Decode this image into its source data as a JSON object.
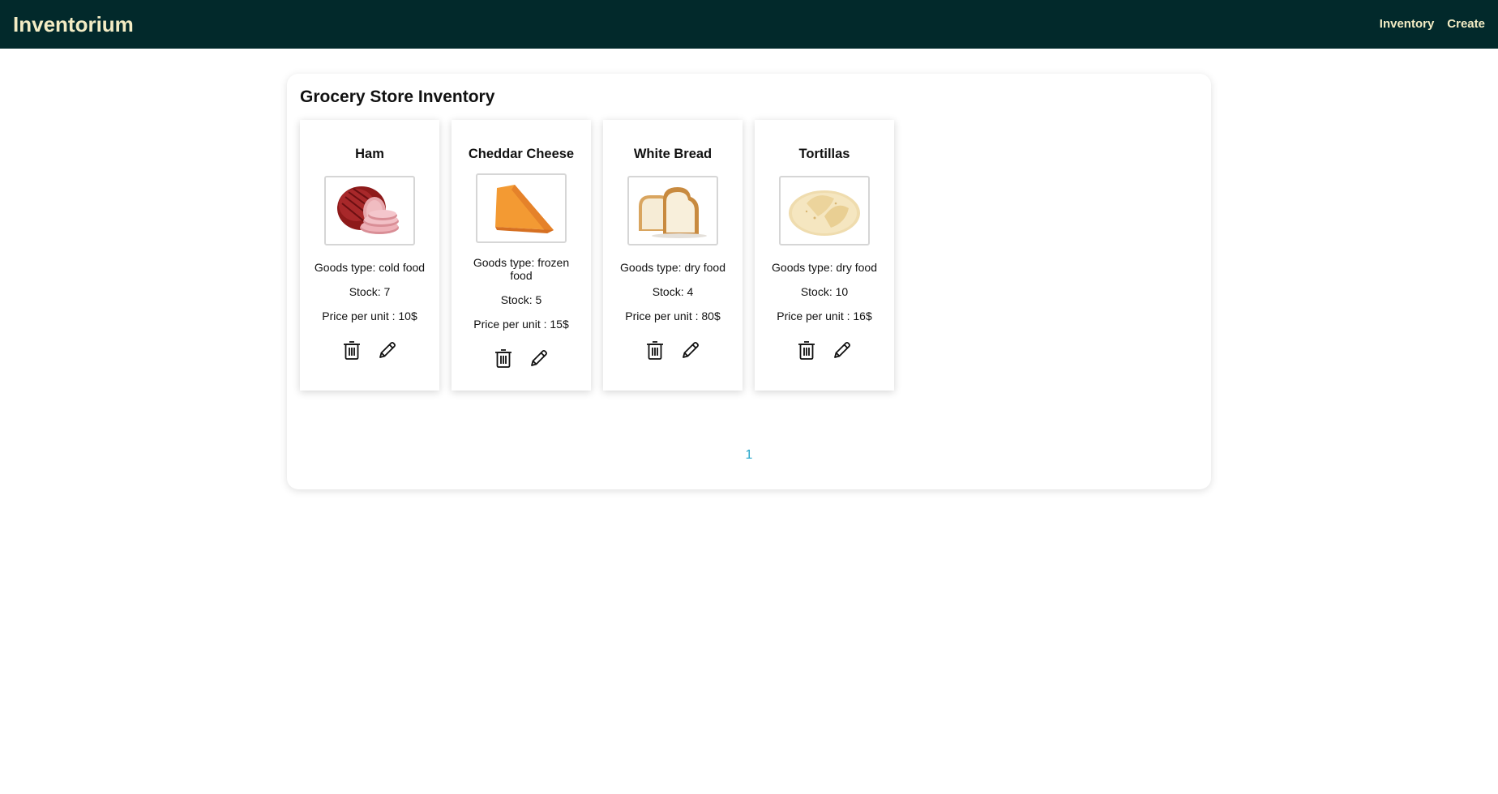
{
  "app": {
    "brand": "Inventorium"
  },
  "nav": {
    "items": [
      "Inventory",
      "Create"
    ]
  },
  "page": {
    "title": "Grocery Store Inventory"
  },
  "products": [
    {
      "name": "Ham",
      "goods": "Goods type: cold food",
      "stock": "Stock: 7",
      "price": "Price per unit : 10$",
      "image": "ham"
    },
    {
      "name": "Cheddar Cheese",
      "goods": "Goods type: frozen food",
      "stock": "Stock: 5",
      "price": "Price per unit : 15$",
      "image": "cheddar-cheese"
    },
    {
      "name": "White Bread",
      "goods": "Goods type: dry food",
      "stock": "Stock: 4",
      "price": "Price per unit : 80$",
      "image": "white-bread"
    },
    {
      "name": "Tortillas",
      "goods": "Goods type: dry food",
      "stock": "Stock: 10",
      "price": "Price per unit : 16$",
      "image": "tortillas"
    }
  ],
  "icons": {
    "delete": "trash-icon",
    "edit": "pencil-icon"
  },
  "pagination": {
    "current": "1"
  },
  "colors": {
    "navbar": "#02292b",
    "brand_text": "#f3ecc4",
    "page_link": "#21a4c9"
  }
}
